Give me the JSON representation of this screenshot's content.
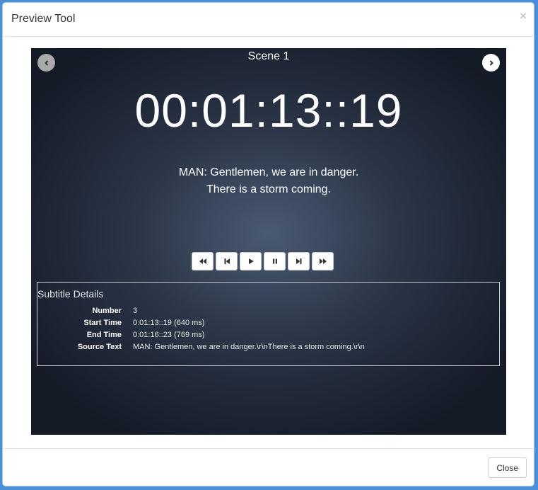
{
  "dialog": {
    "title": "Preview Tool",
    "close_glyph": "×",
    "close_button_label": "Close"
  },
  "preview": {
    "scene_title": "Scene 1",
    "timecode": "00:01:13::19",
    "subtitle_lines": [
      "MAN: Gentlemen, we are in danger.",
      "There is a storm coming."
    ],
    "prev_icon": "chevron-left-icon",
    "next_icon": "chevron-right-icon"
  },
  "controls": [
    {
      "name": "rewind",
      "icon": "fast-backward-icon"
    },
    {
      "name": "step-back",
      "icon": "step-backward-icon"
    },
    {
      "name": "play",
      "icon": "play-icon"
    },
    {
      "name": "pause",
      "icon": "pause-icon"
    },
    {
      "name": "step-forward",
      "icon": "step-forward-icon"
    },
    {
      "name": "fast-forward",
      "icon": "fast-forward-icon"
    }
  ],
  "details": {
    "title": "Subtitle Details",
    "rows": [
      {
        "label": "Number",
        "value": "3"
      },
      {
        "label": "Start Time",
        "value": "0:01:13::19 (640 ms)"
      },
      {
        "label": "End Time",
        "value": "0:01:16::23 (769 ms)"
      },
      {
        "label": "Source Text",
        "value": "MAN: Gentlemen, we are in danger.\\r\\nThere is a storm coming.\\r\\n"
      }
    ]
  },
  "colors": {
    "page_background": "#4a90d9",
    "stage_center": "#4a5a72",
    "stage_edge": "#141a26"
  }
}
